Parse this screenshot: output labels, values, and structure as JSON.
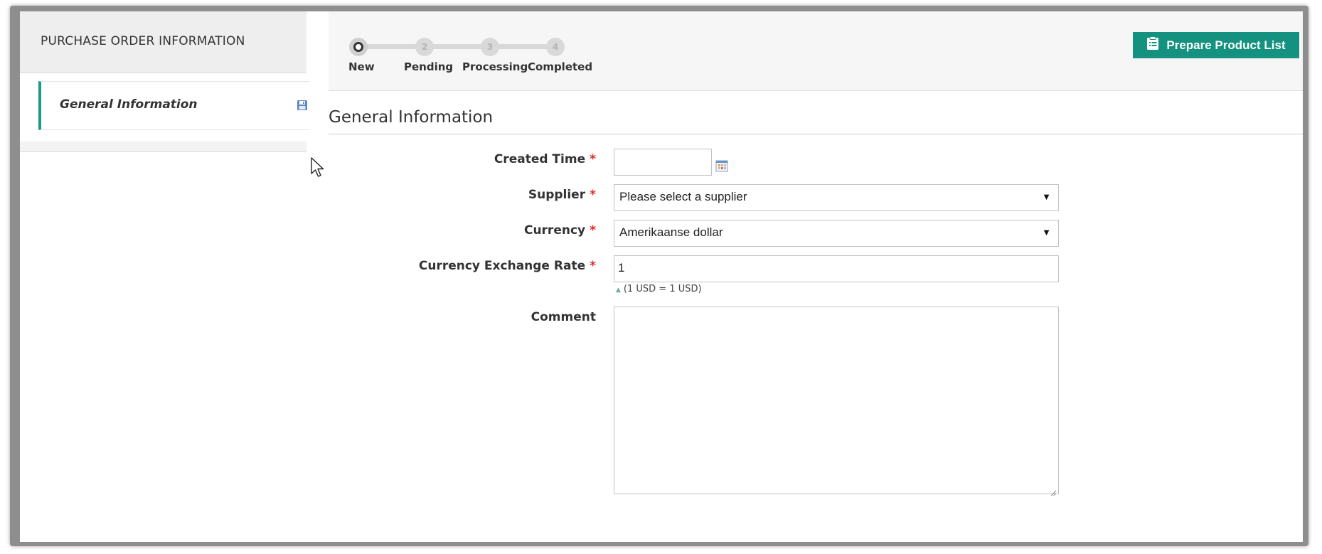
{
  "sidebar": {
    "header": "PURCHASE ORDER INFORMATION",
    "items": [
      {
        "label": "General Information",
        "icon": "save-icon",
        "active": true
      }
    ]
  },
  "steps": [
    {
      "number": "",
      "label": "New",
      "state": "current"
    },
    {
      "number": "2",
      "label": "Pending",
      "state": "upcoming"
    },
    {
      "number": "3",
      "label": "Processing",
      "state": "upcoming"
    },
    {
      "number": "4",
      "label": "Completed",
      "state": "upcoming"
    }
  ],
  "toolbar": {
    "prepare_label": "Prepare Product List",
    "prepare_icon": "clipboard-list-icon",
    "accent_color": "#14927f"
  },
  "section": {
    "title": "General Information"
  },
  "form": {
    "created_time": {
      "label": "Created Time",
      "value": "",
      "required": "*"
    },
    "supplier": {
      "label": "Supplier",
      "value": "Please select a supplier",
      "required": "*"
    },
    "currency": {
      "label": "Currency",
      "value": "Amerikaanse dollar",
      "required": "*"
    },
    "exchange_rate": {
      "label": "Currency Exchange Rate",
      "value": "1",
      "required": "*",
      "note": "(1 USD = 1 USD)"
    },
    "comment": {
      "label": "Comment",
      "value": ""
    }
  }
}
